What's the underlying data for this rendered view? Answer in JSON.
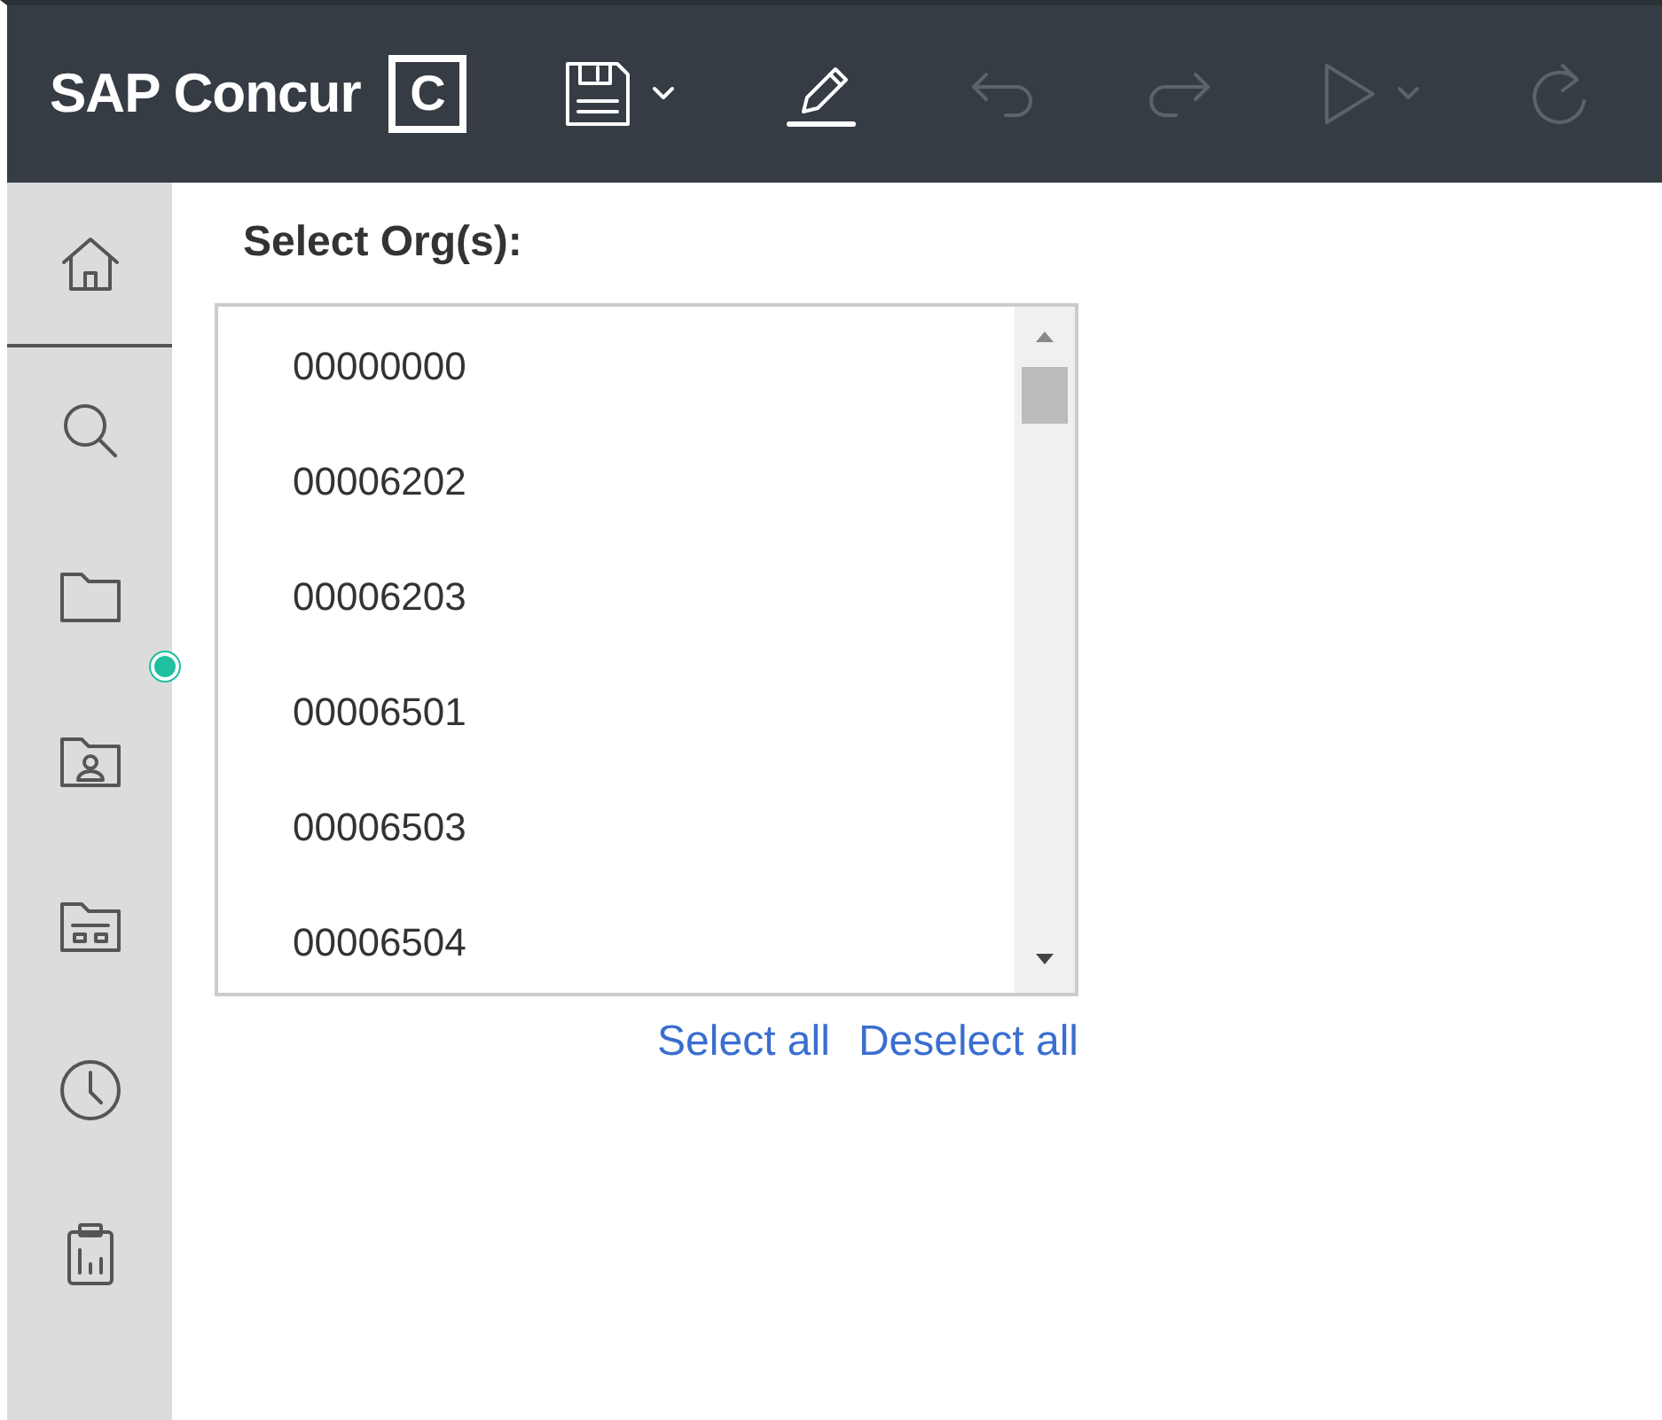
{
  "header": {
    "brand": "SAP Concur",
    "logo_letter": "C"
  },
  "toolbar": [
    {
      "kind": "save",
      "disabled": false,
      "dropdown": true
    },
    {
      "kind": "edit",
      "disabled": false,
      "dropdown": false
    },
    {
      "kind": "undo",
      "disabled": true,
      "dropdown": false
    },
    {
      "kind": "redo",
      "disabled": true,
      "dropdown": false
    },
    {
      "kind": "run",
      "disabled": true,
      "dropdown": true
    },
    {
      "kind": "refresh",
      "disabled": true,
      "dropdown": false
    }
  ],
  "sidebar": {
    "items": [
      {
        "kind": "home",
        "notification": false
      },
      {
        "kind": "search",
        "notification": false
      },
      {
        "kind": "folder",
        "notification": true
      },
      {
        "kind": "user-folder",
        "notification": false
      },
      {
        "kind": "dashboard-folder",
        "notification": false
      },
      {
        "kind": "history",
        "notification": false
      },
      {
        "kind": "report",
        "notification": false
      }
    ]
  },
  "org_select": {
    "label": "Select Org(s):",
    "options": [
      {
        "text": "00000000",
        "selected": false
      },
      {
        "text": "00006202",
        "selected": false
      },
      {
        "text": "00006203",
        "selected": false
      },
      {
        "text": "00006501",
        "selected": false
      },
      {
        "text": "00006503",
        "selected": false
      },
      {
        "text": "00006504",
        "selected": false
      }
    ],
    "links": [
      "Select all",
      "Deselect all"
    ]
  }
}
